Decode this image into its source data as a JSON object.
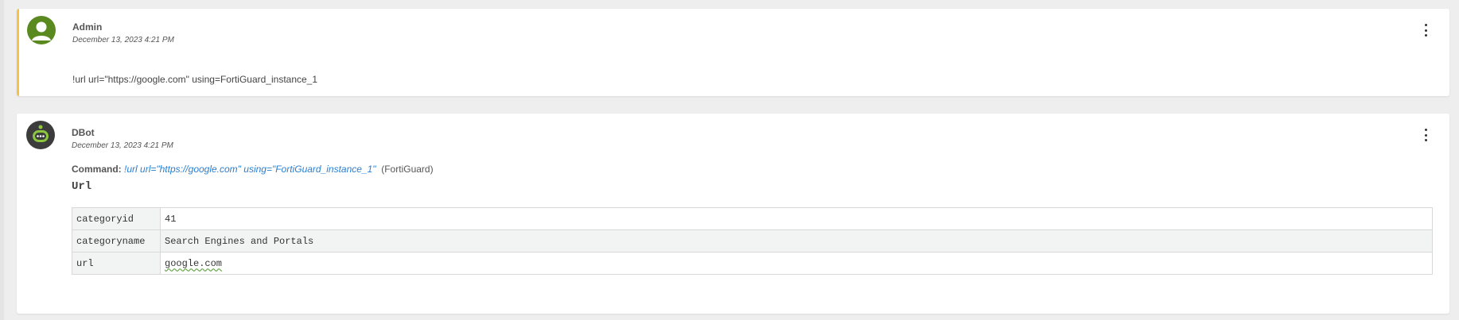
{
  "colors": {
    "admin_accent": "#f7c244",
    "link": "#2a7fd1",
    "admin_avatar": "#5a8a1f",
    "dbot_avatar": "#3c3c3c"
  },
  "entries": [
    {
      "author": "Admin",
      "timestamp": "December 13, 2023 4:21 PM",
      "avatar_icon": "user-avatar-icon",
      "message": "!url url=\"https://google.com\" using=FortiGuard_instance_1"
    },
    {
      "author": "DBot",
      "timestamp": "December 13, 2023 4:21 PM",
      "avatar_icon": "dbot-avatar-icon",
      "command_label": "Command:",
      "command_link": "!url url=\"https://google.com\" using=\"FortiGuard_instance_1\"",
      "command_brand": "(FortiGuard)",
      "result_title": "Url",
      "table_rows": [
        {
          "key": "categoryid",
          "value": "41"
        },
        {
          "key": "categoryname",
          "value": "Search Engines and Portals"
        },
        {
          "key": "url",
          "value": "google.com"
        }
      ]
    }
  ]
}
